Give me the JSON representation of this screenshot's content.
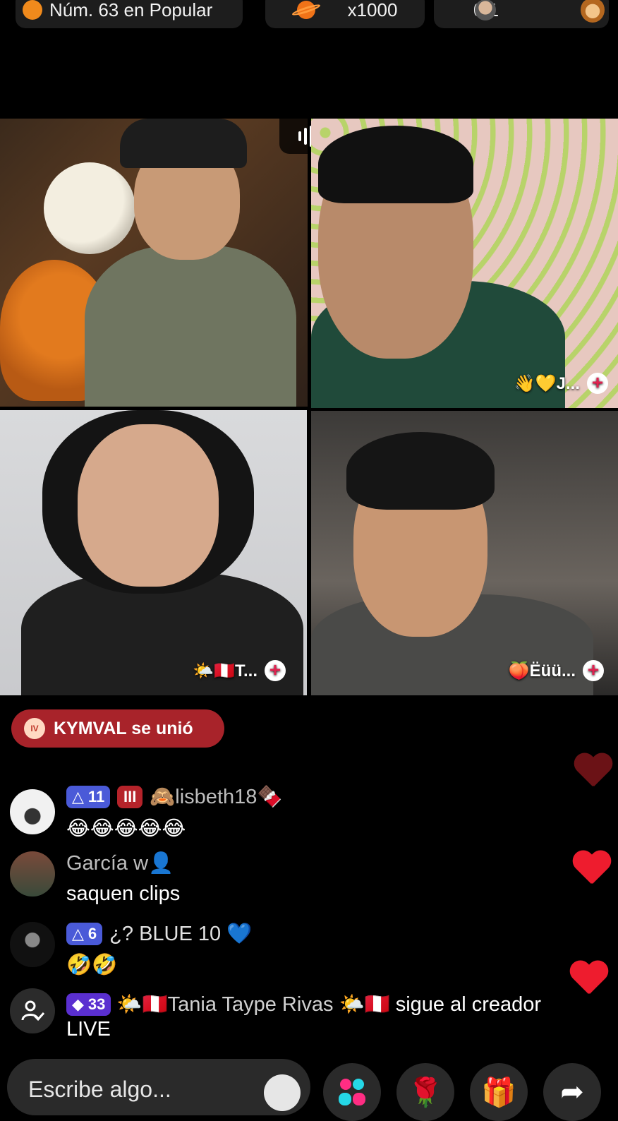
{
  "top_bar": {
    "rank_text": "Núm. 63 en Popular",
    "multiplier": "x1000",
    "guests": "0/1"
  },
  "tiles": [
    {
      "tag": ""
    },
    {
      "tag": "👋💛J..."
    },
    {
      "tag": "🌤️🇵🇪T..."
    },
    {
      "tag": "🍑Ëüü..."
    }
  ],
  "joined": {
    "text": "KYMVAL se unió",
    "badge": "IV"
  },
  "comments": [
    {
      "level": "11",
      "badge": "III",
      "user": "🙈lisbeth18🍫",
      "text": "😂😂😂😂😂"
    },
    {
      "level": "",
      "badge": "",
      "user": "García w👤",
      "text": "saquen clips"
    },
    {
      "level": "6",
      "badge": "",
      "user": "¿? BLUE 10 💙",
      "text": "🤣🤣"
    },
    {
      "level": "33",
      "badge": "",
      "user": "🌤️🇵🇪Tania Taype Rivas 🌤️🇵🇪",
      "text": "sigue al creador",
      "text2": "LIVE"
    }
  ],
  "bottom": {
    "input_placeholder": "Escribe algo...",
    "buttons": [
      "🌹",
      "🎁",
      "➦"
    ]
  },
  "colors": {
    "accent_red": "#ee1c2e",
    "joined_pill": "#a8232a",
    "level_blue": "#4a5ad8"
  }
}
